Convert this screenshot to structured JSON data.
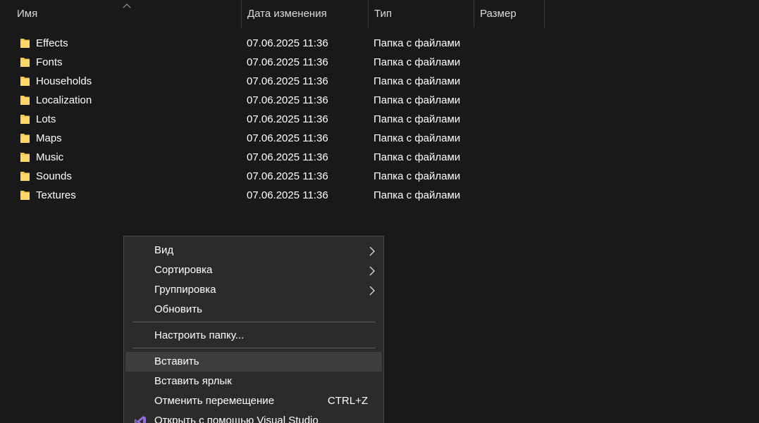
{
  "columns": {
    "name": "Имя",
    "date": "Дата изменения",
    "type": "Тип",
    "size": "Размер"
  },
  "files": [
    {
      "name": "Effects",
      "date": "07.06.2025 11:36",
      "type": "Папка с файлами",
      "size": ""
    },
    {
      "name": "Fonts",
      "date": "07.06.2025 11:36",
      "type": "Папка с файлами",
      "size": ""
    },
    {
      "name": "Households",
      "date": "07.06.2025 11:36",
      "type": "Папка с файлами",
      "size": ""
    },
    {
      "name": "Localization",
      "date": "07.06.2025 11:36",
      "type": "Папка с файлами",
      "size": ""
    },
    {
      "name": "Lots",
      "date": "07.06.2025 11:36",
      "type": "Папка с файлами",
      "size": ""
    },
    {
      "name": "Maps",
      "date": "07.06.2025 11:36",
      "type": "Папка с файлами",
      "size": ""
    },
    {
      "name": "Music",
      "date": "07.06.2025 11:36",
      "type": "Папка с файлами",
      "size": ""
    },
    {
      "name": "Sounds",
      "date": "07.06.2025 11:36",
      "type": "Папка с файлами",
      "size": ""
    },
    {
      "name": "Textures",
      "date": "07.06.2025 11:36",
      "type": "Папка с файлами",
      "size": ""
    }
  ],
  "context_menu": {
    "view": "Вид",
    "sort": "Сортировка",
    "group": "Группировка",
    "refresh": "Обновить",
    "customize": "Настроить папку...",
    "paste": "Вставить",
    "paste_shortcut": "Вставить ярлык",
    "undo_move": "Отменить перемещение",
    "undo_move_shortcut": "CTRL+Z",
    "open_with_vs": "Открыть с помощью Visual Studio"
  },
  "icons": {
    "folder": "folder-icon",
    "submenu": "chevron-right-icon",
    "sort": "sort-up-icon",
    "visual_studio": "visual-studio-icon"
  },
  "colors": {
    "background": "#191919",
    "menu_background": "#2b2b2b",
    "folder": "#f7c948",
    "vs_purple": "#8e6ed8"
  }
}
